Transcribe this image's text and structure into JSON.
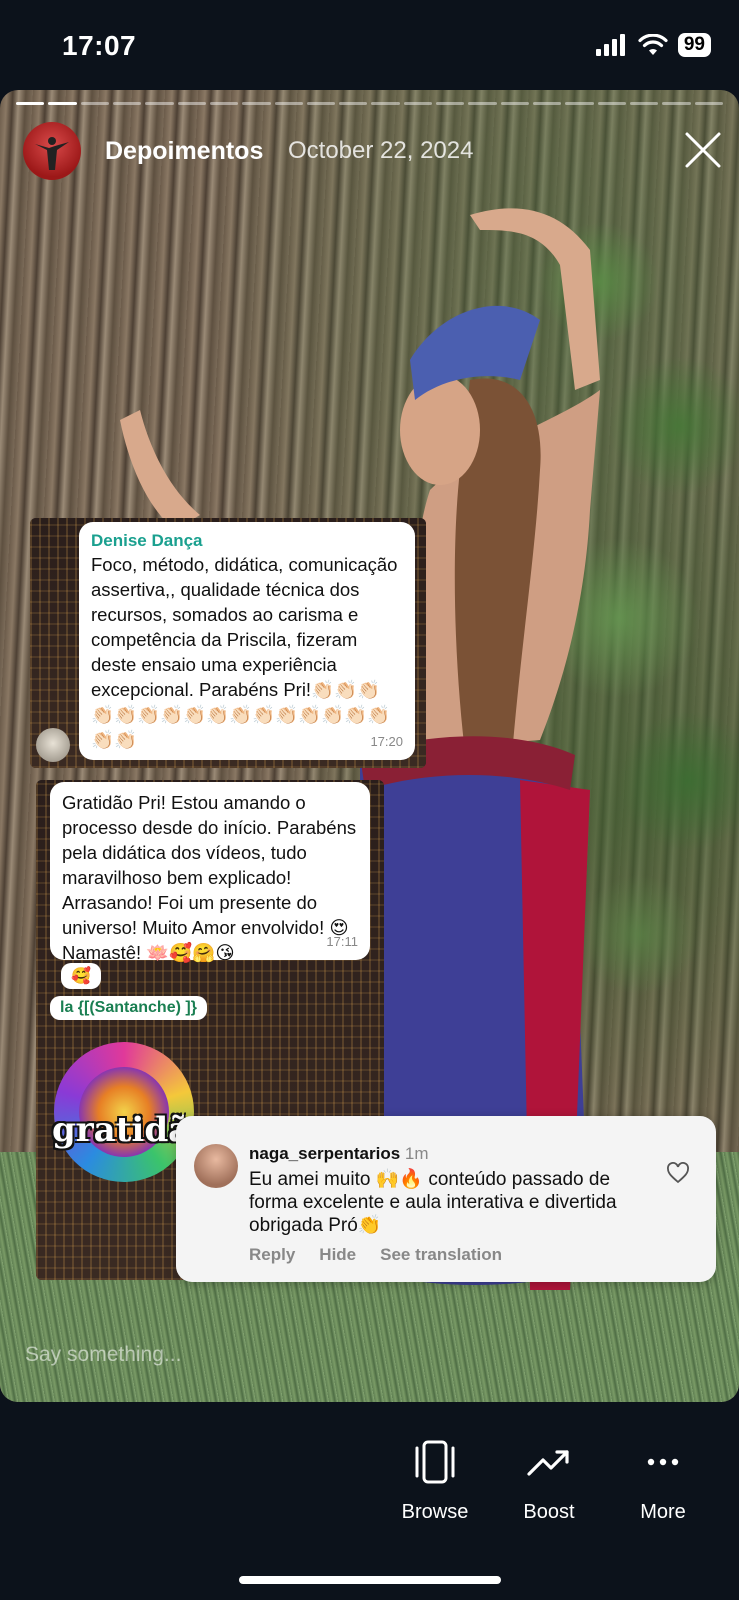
{
  "status_bar": {
    "time": "17:07",
    "battery": "99"
  },
  "story": {
    "progress_total": 22,
    "progress_done": 2,
    "account": "Depoimentos",
    "date": "October 22, 2024"
  },
  "messages": {
    "first": {
      "sender": "Denise Dança",
      "text": "Foco, método, didática, comunicação assertiva,, qualidade técnica dos recursos, somados ao carisma e competência da Priscila, fizeram deste ensaio uma experiência excepcional. Parabéns Pri!👏🏻👏🏻👏🏻👏🏻👏🏻👏🏻👏🏻👏🏻👏🏻👏🏻👏🏻👏🏻👏🏻👏🏻👏🏻👏🏻👏🏻👏🏻",
      "time": "17:20"
    },
    "second": {
      "text": "Gratidão Pri! Estou amando o processo desde do início. Parabéns pela didática dos vídeos, tudo maravilhoso bem explicado! Arrasando! Foi um  presente do universo! Muito Amor envolvido! 😍 Namastê! 🪷🥰🤗😘",
      "time": "17:11"
    },
    "reaction": "🥰",
    "quote": "la {[(Santanche) ]}",
    "sticker_text": "gratidão"
  },
  "comment": {
    "username": "naga_serpentarios",
    "ago": "1m",
    "text": "Eu amei muito 🙌🔥 conteúdo passado de forma excelente e aula interativa e divertida obrigada Pró👏",
    "actions": {
      "reply": "Reply",
      "hide": "Hide",
      "translate": "See translation"
    }
  },
  "input": {
    "placeholder": "Say something..."
  },
  "bottom_bar": {
    "browse": "Browse",
    "boost": "Boost",
    "more": "More"
  }
}
